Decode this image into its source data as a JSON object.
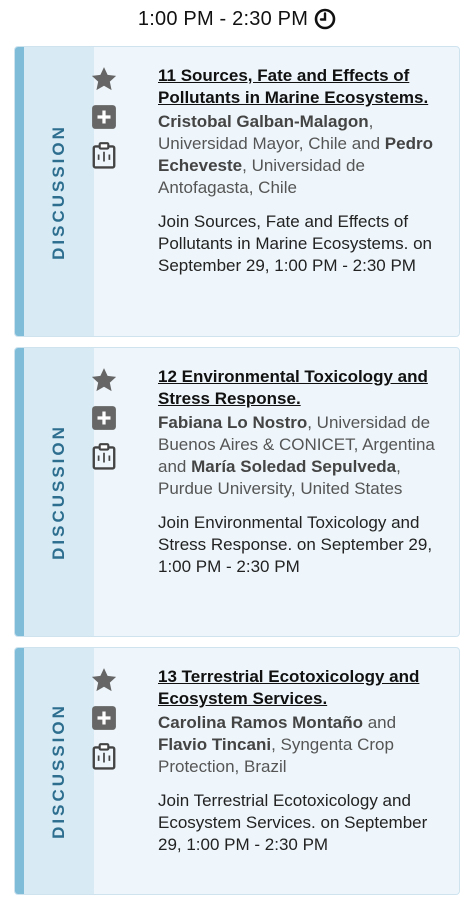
{
  "header": {
    "time": "1:00 PM - 2:30 PM"
  },
  "sessions": [
    {
      "tag": "DISCUSSION",
      "title": "11 Sources, Fate and Effects of Pollutants in Marine Ecosystems.",
      "speakers": [
        {
          "name": "Cristobal Galban-Malagon",
          "affiliation": ", Universidad Mayor, Chile and "
        },
        {
          "name": "Pedro Echeveste",
          "affiliation": ", Universidad de Antofagasta, Chile"
        }
      ],
      "join": "Join Sources, Fate and Effects of Pollutants in Marine Ecosystems. on September 29, 1:00 PM - 2:30 PM"
    },
    {
      "tag": "DISCUSSION",
      "title": "12 Environmental Toxicology and Stress Response.",
      "speakers": [
        {
          "name": "Fabiana Lo Nostro",
          "affiliation": ", Universidad de Buenos Aires & CONICET, Argentina and "
        },
        {
          "name": "María Soledad Sepulveda",
          "affiliation": ", Purdue University, United States"
        }
      ],
      "join": "Join Environmental Toxicology and Stress Response. on September 29, 1:00 PM - 2:30 PM"
    },
    {
      "tag": "DISCUSSION",
      "title": "13 Terrestrial Ecotoxicology and Ecosystem Services.",
      "speakers": [
        {
          "name": "Carolina Ramos Montaño",
          "affiliation": " and "
        },
        {
          "name": "Flavio Tincani",
          "affiliation": ", Syngenta Crop Protection, Brazil"
        }
      ],
      "join": "Join Terrestrial Ecotoxicology and Ecosystem Services. on September 29, 1:00 PM - 2:30 PM"
    }
  ]
}
